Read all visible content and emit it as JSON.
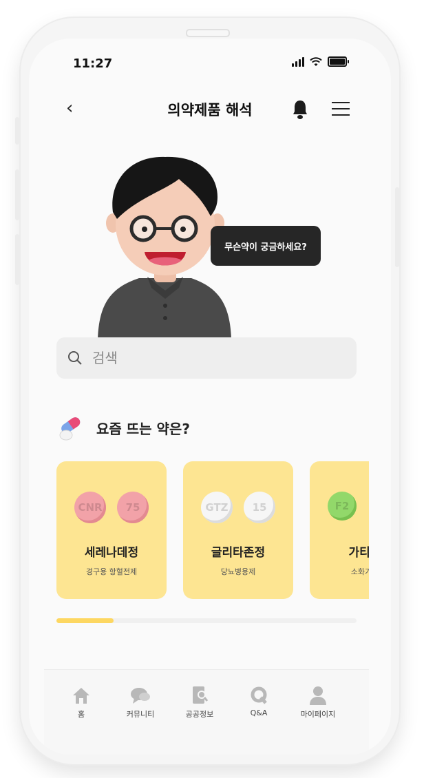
{
  "status_bar": {
    "time": "11:27"
  },
  "header": {
    "back_icon": "‹",
    "title": "의약제품 해석",
    "bell_icon": "bell-icon",
    "menu_icon": "menu-icon"
  },
  "assistant": {
    "speech": "무슨약이 궁금하세요?"
  },
  "search": {
    "placeholder": "검색"
  },
  "trending": {
    "title": "요즘 뜨는 약은?",
    "cards": [
      {
        "name": "세레나데정",
        "desc": "경구용 항혈전제",
        "pill_color": "#f2a2a8",
        "pills": [
          "CNR",
          "75"
        ]
      },
      {
        "name": "글리타존정",
        "desc": "당뇨병용제",
        "pill_color": "#f6f6f6",
        "pills": [
          "GTZ",
          "15"
        ]
      },
      {
        "name": "가티딘",
        "desc": "소화기관",
        "pill_color": "#92d86a",
        "pills": [
          "F2"
        ]
      }
    ],
    "scroll_progress": 0.19
  },
  "bottom_nav": [
    {
      "label": "홈",
      "icon": "home-icon"
    },
    {
      "label": "커뮤니티",
      "icon": "chat-icon"
    },
    {
      "label": "공공정보",
      "icon": "document-search-icon"
    },
    {
      "label": "Q&A",
      "icon": "qa-icon"
    },
    {
      "label": "마이페이지",
      "icon": "person-icon"
    }
  ],
  "colors": {
    "accent": "#fdd761",
    "card_bg": "#fde592",
    "bubble": "#262626"
  }
}
